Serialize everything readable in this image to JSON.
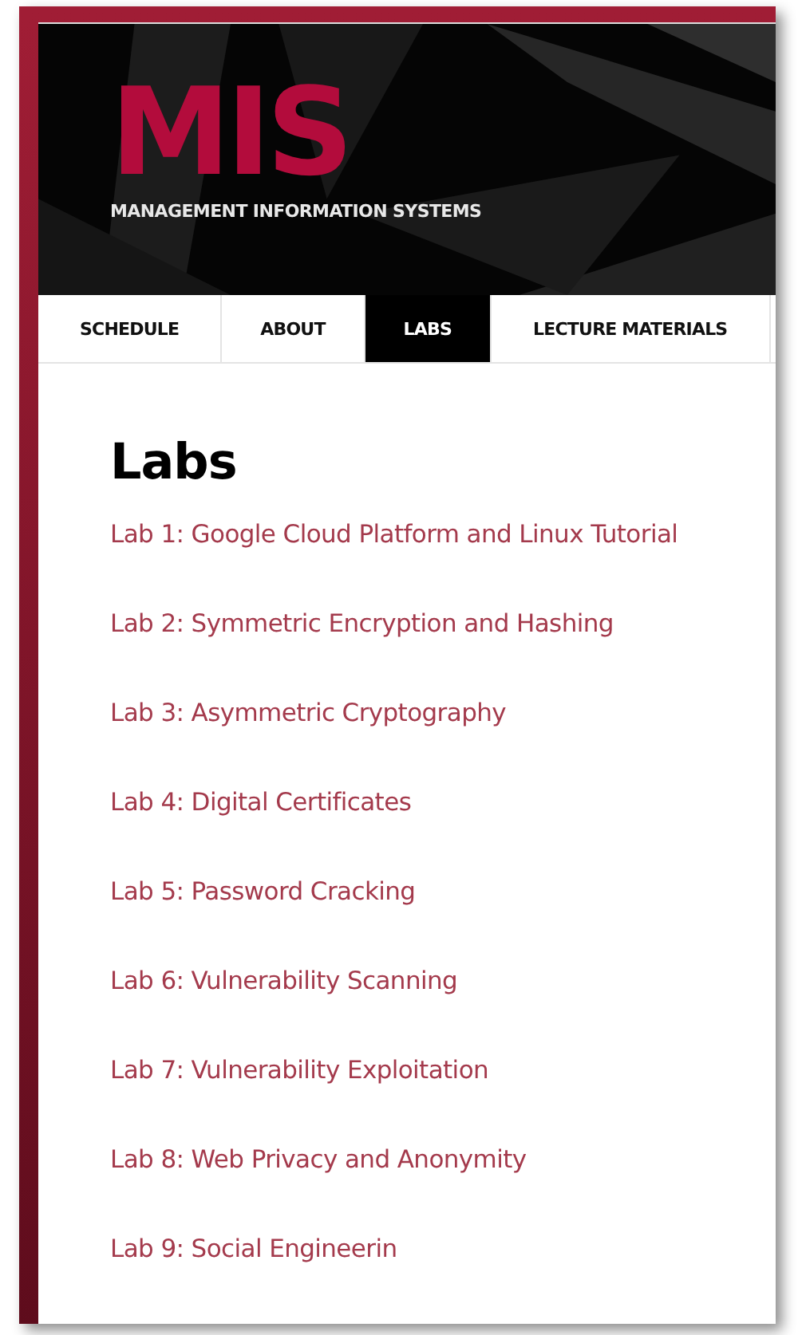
{
  "header": {
    "logo": "MIS",
    "subtitle": "MANAGEMENT INFORMATION SYSTEMS"
  },
  "nav": [
    {
      "label": "SCHEDULE",
      "selected": false
    },
    {
      "label": "ABOUT",
      "selected": false
    },
    {
      "label": "LABS",
      "selected": true
    },
    {
      "label": "LECTURE MATERIALS",
      "selected": false
    }
  ],
  "page_title": "Labs",
  "labs": [
    "Lab 1: Google Cloud Platform and Linux Tutorial",
    "Lab 2: Symmetric Encryption and Hashing",
    "Lab 3: Asymmetric Cryptography",
    "Lab 4: Digital Certificates",
    "Lab 5: Password Cracking",
    "Lab 6: Vulnerability Scanning",
    "Lab 7: Vulnerability Exploitation",
    "Lab 8: Web Privacy and Anonymity",
    "Lab 9: Social Engineerin"
  ]
}
